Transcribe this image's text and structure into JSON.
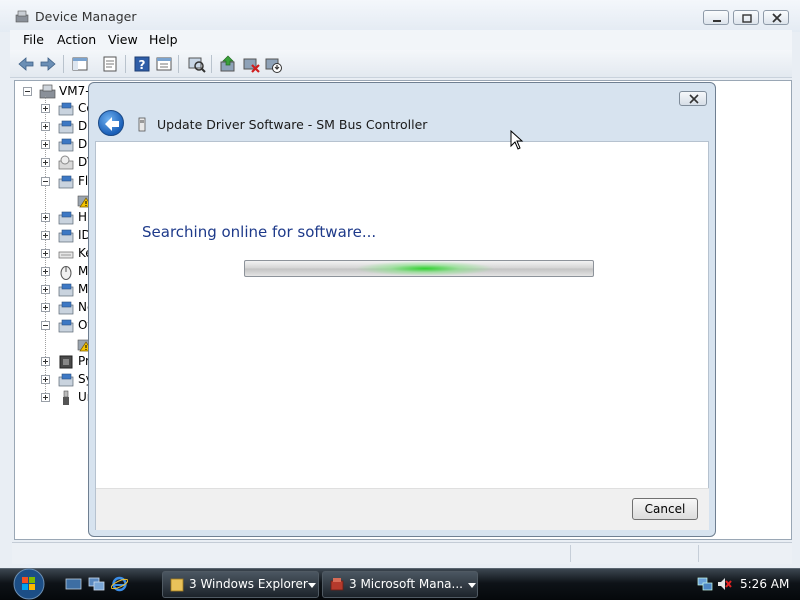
{
  "window": {
    "title": "Device Manager"
  },
  "menu": {
    "file": "File",
    "action": "Action",
    "view": "View",
    "help": "Help"
  },
  "tree": {
    "root": "VM7-",
    "items": [
      {
        "label": "Co",
        "icon": "computer-icon",
        "expander": "plus"
      },
      {
        "label": "Di",
        "icon": "disk-drive-icon",
        "expander": "plus"
      },
      {
        "label": "Di",
        "icon": "display-adapter-icon",
        "expander": "plus"
      },
      {
        "label": "DV",
        "icon": "dvd-drive-icon",
        "expander": "plus"
      },
      {
        "label": "Fl",
        "icon": "floppy-controller-icon",
        "expander": "minus"
      },
      {
        "label": "",
        "icon": "warning-device-icon",
        "expander": "none"
      },
      {
        "label": "Hu",
        "icon": "hid-icon",
        "expander": "plus"
      },
      {
        "label": "ID",
        "icon": "ide-controller-icon",
        "expander": "plus"
      },
      {
        "label": "Ke",
        "icon": "keyboard-icon",
        "expander": "plus"
      },
      {
        "label": "M",
        "icon": "mouse-icon",
        "expander": "plus"
      },
      {
        "label": "M",
        "icon": "monitor-icon",
        "expander": "plus"
      },
      {
        "label": "Ne",
        "icon": "network-adapter-icon",
        "expander": "plus"
      },
      {
        "label": "Ot",
        "icon": "other-devices-icon",
        "expander": "minus"
      },
      {
        "label": "",
        "icon": "warning-device-icon",
        "expander": "none"
      },
      {
        "label": "Pr",
        "icon": "processor-icon",
        "expander": "plus"
      },
      {
        "label": "Sy",
        "icon": "system-devices-icon",
        "expander": "plus"
      },
      {
        "label": "Ur",
        "icon": "usb-controller-icon",
        "expander": "plus"
      }
    ]
  },
  "dialog": {
    "title": "Update Driver Software - SM Bus Controller",
    "status": "Searching online for software...",
    "cancel": "Cancel"
  },
  "taskbar": {
    "explorer": "3  Windows Explorer",
    "microsoft": "3  Microsoft Mana...",
    "clock": "5:26 AM"
  },
  "colors": {
    "status_text": "#1e3a8a",
    "progress_glow": "#28d228",
    "warning": "#f5c400"
  }
}
